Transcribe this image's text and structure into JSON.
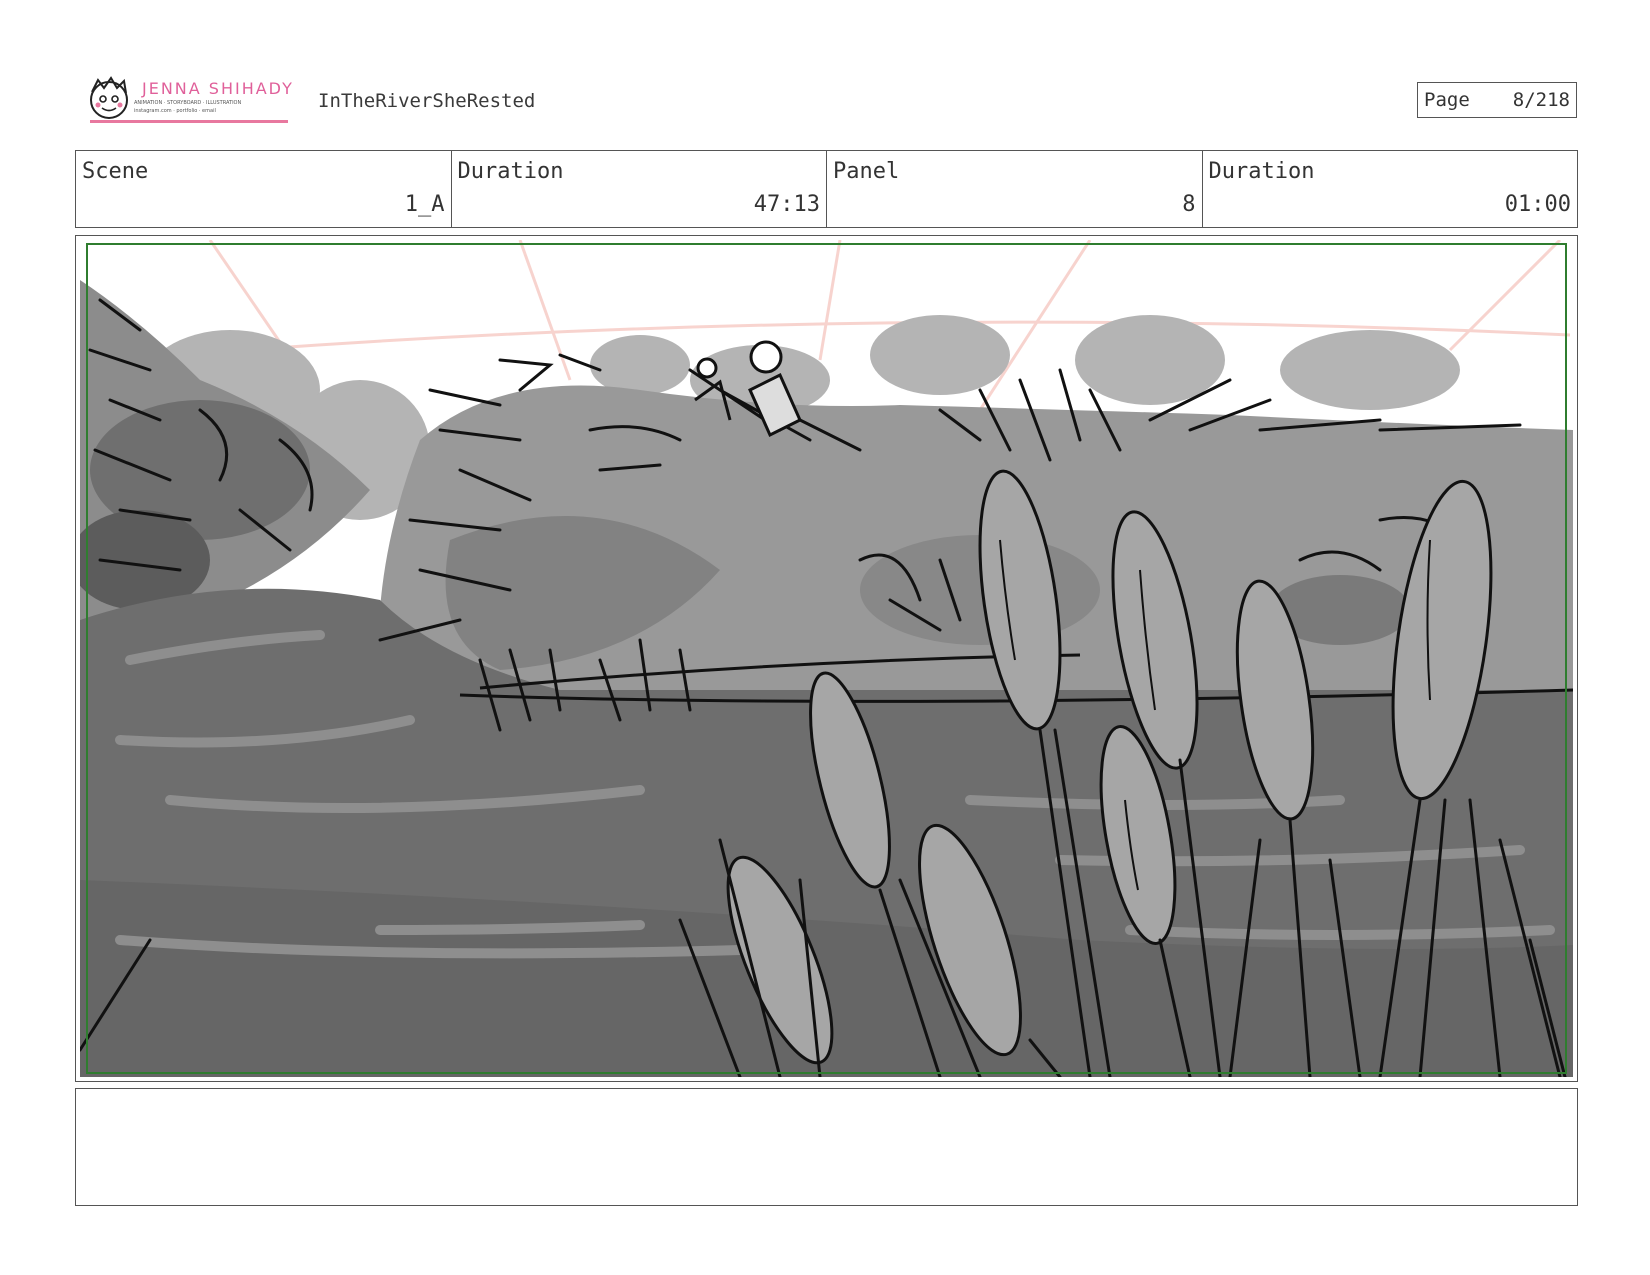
{
  "header": {
    "logo": {
      "name": "JENNA SHIHADY",
      "tagline": "ANIMATION · STORYBOARD · ILLUSTRATION",
      "contact": "instagram.com · portfolio · email"
    },
    "project_title": "InTheRiverSheRested",
    "page": {
      "label": "Page",
      "value": "8/218"
    }
  },
  "info": {
    "scene": {
      "label": "Scene",
      "value": "1_A"
    },
    "scene_duration": {
      "label": "Duration",
      "value": "47:13"
    },
    "panel": {
      "label": "Panel",
      "value": "8"
    },
    "panel_duration": {
      "label": "Duration",
      "value": "01:00"
    }
  },
  "frame": {
    "safe_area_color": "#2f7d2f",
    "guide_color": "#f6c9c3"
  },
  "notes": {
    "text": ""
  }
}
